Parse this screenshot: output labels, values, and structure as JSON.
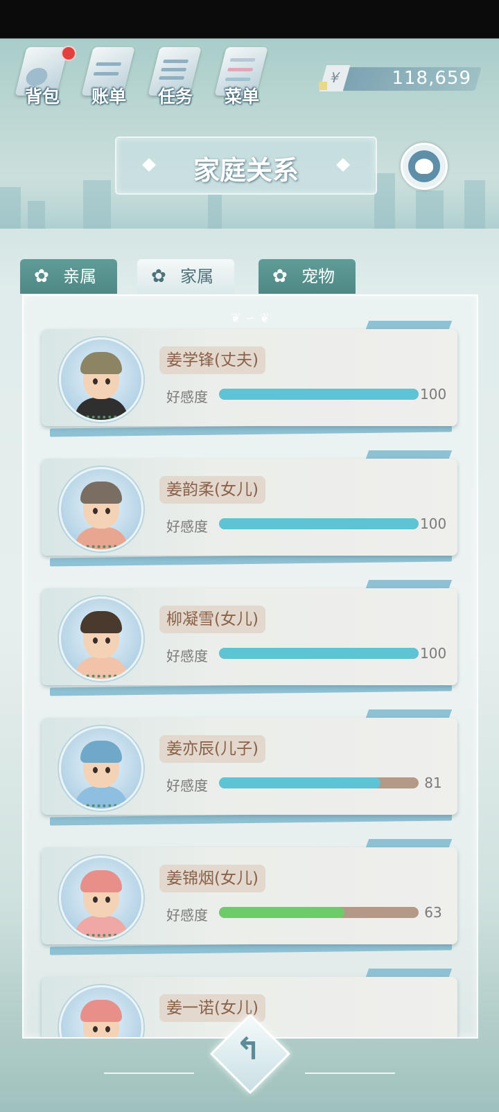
{
  "top_nav": [
    {
      "label": "背包",
      "icon": "bag-icon",
      "badge": true
    },
    {
      "label": "账单",
      "icon": "bill-icon",
      "badge": false
    },
    {
      "label": "任务",
      "icon": "task-icon",
      "badge": false
    },
    {
      "label": "菜单",
      "icon": "menu-icon",
      "badge": false
    }
  ],
  "currency": {
    "symbol": "¥",
    "value": "118,659"
  },
  "title": "家庭关系",
  "tabs": [
    {
      "label": "亲属",
      "active": false
    },
    {
      "label": "家属",
      "active": true
    },
    {
      "label": "宠物",
      "active": false
    }
  ],
  "affection_label": "好感度",
  "members": [
    {
      "name": "姜学锋(丈夫)",
      "affection": 100,
      "affection_text": "100",
      "bar_color": "#5fc3d6",
      "hair": "#8c8462",
      "outfit": "#2f2f2f"
    },
    {
      "name": "姜韵柔(女儿)",
      "affection": 100,
      "affection_text": "100",
      "bar_color": "#5fc3d6",
      "hair": "#7a6d62",
      "outfit": "#e8a58f"
    },
    {
      "name": "柳凝雪(女儿)",
      "affection": 100,
      "affection_text": "100",
      "bar_color": "#5fc3d6",
      "hair": "#4a3a2e",
      "outfit": "#f2c3a8"
    },
    {
      "name": "姜亦辰(儿子)",
      "affection": 81,
      "affection_text": "81",
      "bar_color": "#5fc3d6",
      "hair": "#6fa8c8",
      "outfit": "#8fbfe0"
    },
    {
      "name": "姜锦烟(女儿)",
      "affection": 63,
      "affection_text": "63",
      "bar_color": "#6ecb6a",
      "hair": "#e88f8a",
      "outfit": "#f0a8a4"
    },
    {
      "name": "姜一诺(女儿)",
      "affection": null,
      "affection_text": "",
      "bar_color": "#6ecb6a",
      "hair": "#e88f8a",
      "outfit": "#f0a8a4"
    }
  ],
  "back_button": "back-arrow-icon"
}
